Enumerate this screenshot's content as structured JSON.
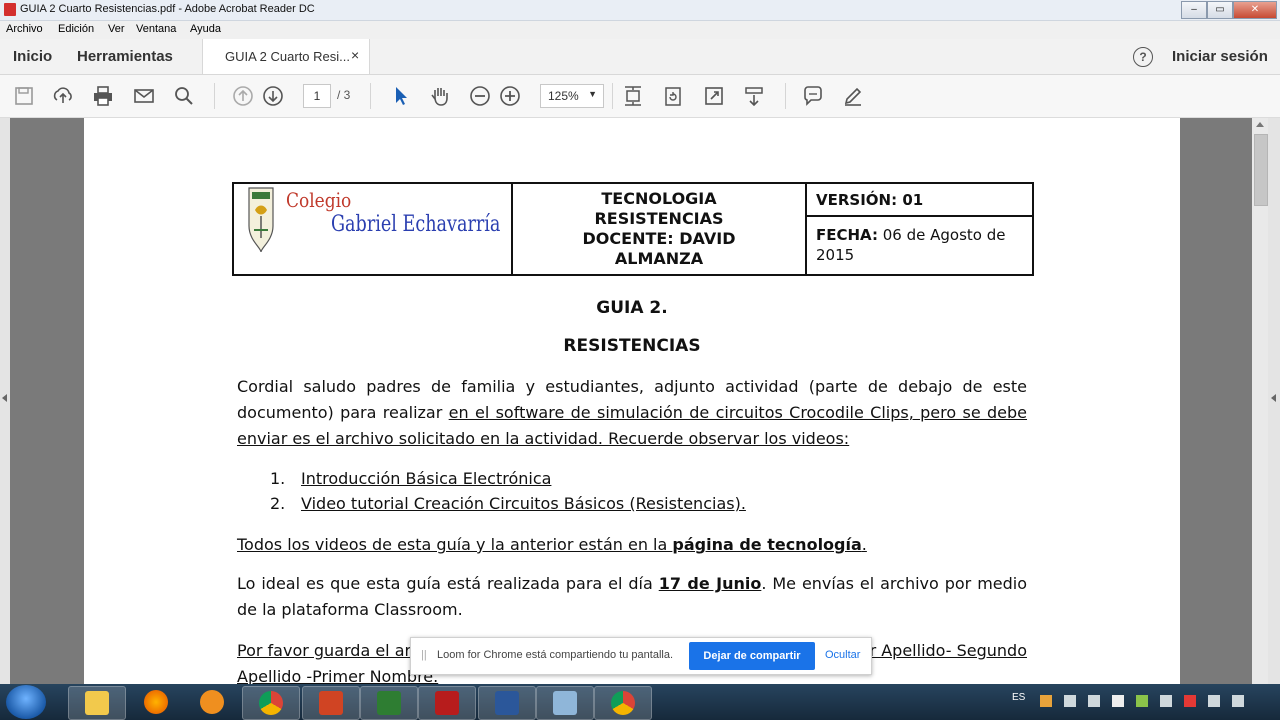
{
  "window": {
    "title": "GUIA 2 Cuarto Resistencias.pdf - Adobe Acrobat Reader DC",
    "controls": [
      "–",
      "▭",
      "✕"
    ]
  },
  "menu": [
    "Archivo",
    "Edición",
    "Ver",
    "Ventana",
    "Ayuda"
  ],
  "tabs": {
    "home": "Inicio",
    "tools": "Herramientas",
    "document": "GUIA 2 Cuarto Resi...",
    "close": "×",
    "help": "?",
    "signin": "Iniciar sesión"
  },
  "toolbar": {
    "page_current": "1",
    "page_total": "/ 3",
    "zoom": "125%",
    "zoom_caret": "▼",
    "icons": [
      "save-icon",
      "upload-icon",
      "print-icon",
      "email-icon",
      "search-icon",
      "page-up-icon",
      "page-down-icon",
      "select-cursor-icon",
      "hand-icon",
      "zoom-out-icon",
      "zoom-in-icon",
      "fit-page-icon",
      "rotate-icon",
      "fullscreen-icon",
      "scroll-mode-icon",
      "comment-icon",
      "pen-icon"
    ]
  },
  "document": {
    "header": {
      "logo_top": "Colegio",
      "logo_bottom": "Gabriel Echavarría",
      "center_lines": [
        "TECNOLOGIA",
        "RESISTENCIAS",
        "DOCENTE: DAVID",
        "ALMANZA"
      ],
      "version_label": "VERSIÓN:",
      "version_value": "01",
      "date_label": "FECHA:",
      "date_value": "06 de Agosto de 2015"
    },
    "title": "GUIA 2.",
    "subtitle": "RESISTENCIAS",
    "para1_plain": "Cordial saludo padres de familia y estudiantes, adjunto actividad (parte de debajo de este documento) para realizar ",
    "para1_underlined": "en el software de simulación de circuitos Crocodile Clips, pero se debe enviar es el archivo solicitado en la actividad. Recuerde observar los videos:",
    "videos": [
      {
        "num": "1.",
        "label": "Introducción Básica Electrónica"
      },
      {
        "num": "2.",
        "label": "Video tutorial Creación Circuitos Básicos (Resistencias)."
      }
    ],
    "para2_a": "Todos los videos de esta guía y la anterior están en la ",
    "para2_b": "página de tecnología",
    "para2_c": ".",
    "para3_a": "Lo ideal es que esta guía está realizada para el día ",
    "para3_b": "17 de Junio",
    "para3_c": ". Me envías el archivo por medio de la plataforma Classroom.",
    "para4_a": "Por favor guarda el ar",
    "para4_b": "r Apellido- Segundo",
    "para4_c": "Apellido -Primer Nombre."
  },
  "loom": {
    "grip": "||",
    "message": "Loom for Chrome está compartiendo tu pantalla.",
    "stop": "Dejar de compartir",
    "hide": "Ocultar"
  },
  "taskbar": {
    "apps": [
      "start",
      "explorer",
      "firefox",
      "media-player",
      "chrome",
      "powerpoint",
      "crocodile",
      "acrobat",
      "word",
      "control-panel",
      "chrome-2"
    ],
    "language": "ES"
  },
  "colors": {
    "accent": "#1a73e8",
    "logo_top": "#c0392b",
    "logo_bottom": "#2b3fb0",
    "acrobat_red": "#d32f2f"
  }
}
